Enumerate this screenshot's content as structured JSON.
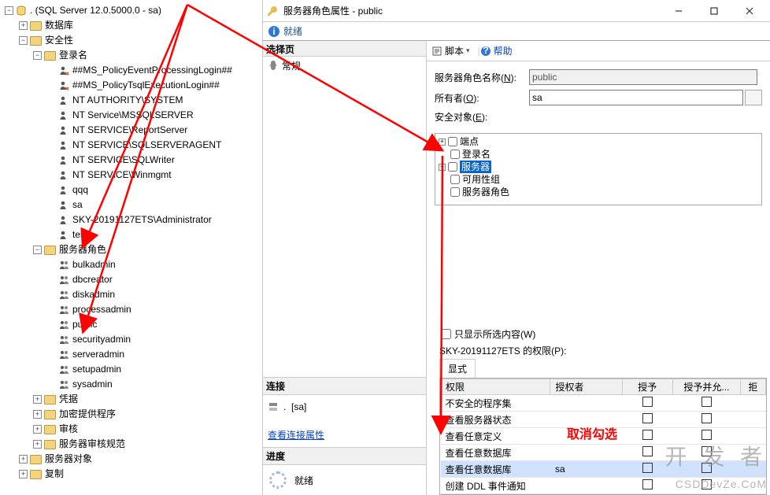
{
  "tree": {
    "root": ". (SQL Server 12.0.5000.0 - sa)",
    "databases": "数据库",
    "security": "安全性",
    "logins_folder": "登录名",
    "logins": [
      "##MS_PolicyEventProcessingLogin##",
      "##MS_PolicyTsqlExecutionLogin##",
      "NT AUTHORITY\\SYSTEM",
      "NT Service\\MSSQLSERVER",
      "NT SERVICE\\ReportServer",
      "NT SERVICE\\SQLSERVERAGENT",
      "NT SERVICE\\SQLWriter",
      "NT SERVICE\\Winmgmt",
      "qqq",
      "sa",
      "SKY-20191127ETS\\Administrator",
      "test"
    ],
    "roles_folder": "服务器角色",
    "roles": [
      "bulkadmin",
      "dbcreator",
      "diskadmin",
      "processadmin",
      "public",
      "securityadmin",
      "serveradmin",
      "setupadmin",
      "sysadmin"
    ],
    "credentials": "凭据",
    "crypto": "加密提供程序",
    "audit": "审核",
    "audit_spec": "服务器审核规范",
    "server_objects": "服务器对象",
    "replication": "复制"
  },
  "dlg": {
    "title": "服务器角色属性 - public",
    "ready": "就绪",
    "select_page": "选择页",
    "general": "常规",
    "connection": "连接",
    "conn_server_label": ".",
    "conn_user": "[sa]",
    "view_conn": "查看连接属性",
    "progress": "进度",
    "progress_state": "就绪",
    "script": "脚本",
    "help": "帮助",
    "role_name_label_prefix": "服务器角色名称(",
    "role_name_key": "N",
    "role_name_label_suffix": "):",
    "role_name": "public",
    "owner_label_prefix": "所有者(",
    "owner_key": "O",
    "owner_label_suffix": "):",
    "owner": "sa",
    "securables_label_prefix": "安全对象(",
    "securables_key": "E",
    "securables_label_suffix": "):",
    "sectree": {
      "endpoints": "端点",
      "logins": "登录名",
      "servers": "服务器",
      "ag": "可用性组",
      "roles": "服务器角色"
    },
    "show_selected_label_prefix": "只显示所选内容(",
    "show_selected_key": "W",
    "show_selected_label_suffix": ")",
    "perm_title": "SKY-20191127ETS 的权限(P):",
    "explicit": "显式",
    "col_perm": "权限",
    "col_grantor": "授权者",
    "col_grant": "授予",
    "col_withgrant": "授予并允...",
    "col_deny": "拒",
    "perms": [
      {
        "name": "不安全的程序集",
        "grantor": "",
        "sel": false
      },
      {
        "name": "查看服务器状态",
        "grantor": "",
        "sel": false
      },
      {
        "name": "查看任意定义",
        "grantor": "",
        "sel": false
      },
      {
        "name": "查看任意数据库",
        "grantor": "",
        "sel": false
      },
      {
        "name": "查看任意数据库",
        "grantor": "sa",
        "sel": true
      },
      {
        "name": "创建 DDL 事件通知",
        "grantor": "",
        "sel": false
      }
    ]
  },
  "annot": {
    "cancel": "取消勾选"
  },
  "wm": {
    "a": "开 发 者",
    "b": "CSDDevZe.CoM"
  }
}
